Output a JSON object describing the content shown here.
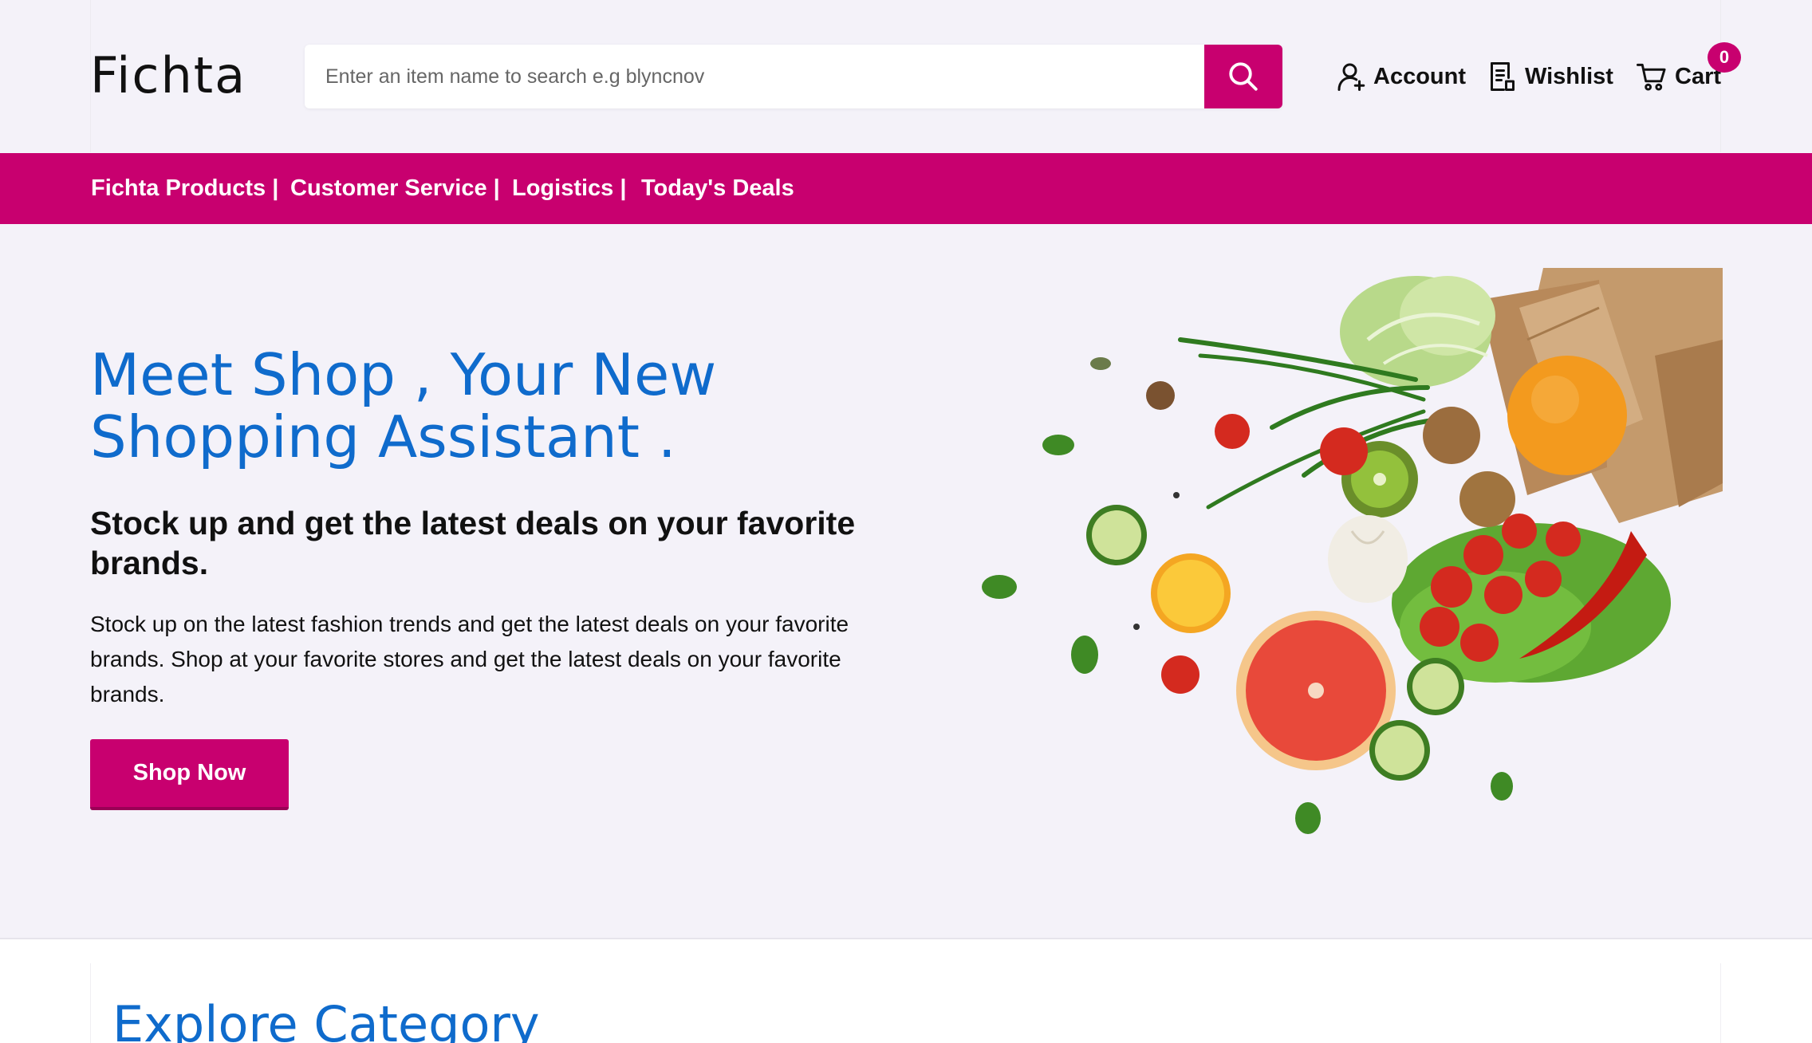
{
  "header": {
    "logo": "Fichta",
    "search": {
      "placeholder": "Enter an item name to search e.g blyncnov",
      "value": ""
    },
    "links": [
      {
        "label": "Account",
        "icon": "user-add-icon"
      },
      {
        "label": "Wishlist",
        "icon": "list-icon"
      },
      {
        "label": "Cart",
        "icon": "cart-icon"
      }
    ],
    "cart_count": "0"
  },
  "nav": {
    "items": [
      {
        "label": "Fichta Products |"
      },
      {
        "label": "Customer Service |"
      },
      {
        "label": "Logistics |"
      },
      {
        "label": "Today's Deals"
      }
    ]
  },
  "hero": {
    "title_line1": "Meet Shop , Your New",
    "title_line2": "Shopping Assistant .",
    "subtitle": "Stock up and get the latest deals on your favorite brands.",
    "body": "Stock up on the latest fashion trends and get the latest deals on your favorite brands. Shop at your favorite stores and get the latest deals on your favorite brands.",
    "button": "Shop Now"
  },
  "category": {
    "title": "Explore Category"
  },
  "colors": {
    "accent": "#c8006f",
    "heading_blue": "#0f6bcc",
    "background": "#f4f2f9"
  }
}
